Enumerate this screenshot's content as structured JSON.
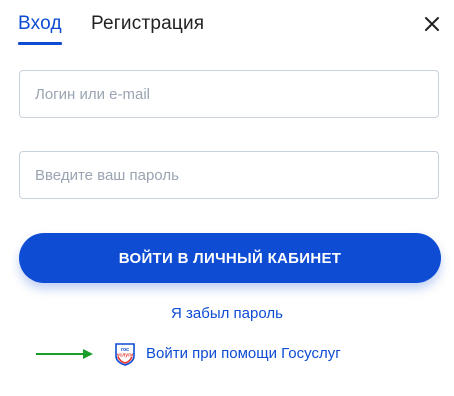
{
  "tabs": {
    "login": "Вход",
    "register": "Регистрация"
  },
  "form": {
    "login_placeholder": "Логин или e-mail",
    "login_value": "",
    "password_placeholder": "Введите ваш пароль",
    "password_value": "",
    "submit_label": "ВОЙТИ В ЛИЧНЫЙ КАБИНЕТ"
  },
  "links": {
    "forgot_password": "Я забыл пароль",
    "gosuslugi": "Войти при помощи Госуслуг",
    "gosuslugi_logo_text_top": "гос",
    "gosuslugi_logo_text_bottom": "услуги"
  },
  "icons": {
    "close": "close-icon",
    "arrow": "arrow-right-icon",
    "gosuslugi": "gosuslugi-logo-icon"
  },
  "colors": {
    "accent": "#0d4cd3",
    "arrow": "#1a9e2a",
    "logo_red": "#e4382f"
  }
}
